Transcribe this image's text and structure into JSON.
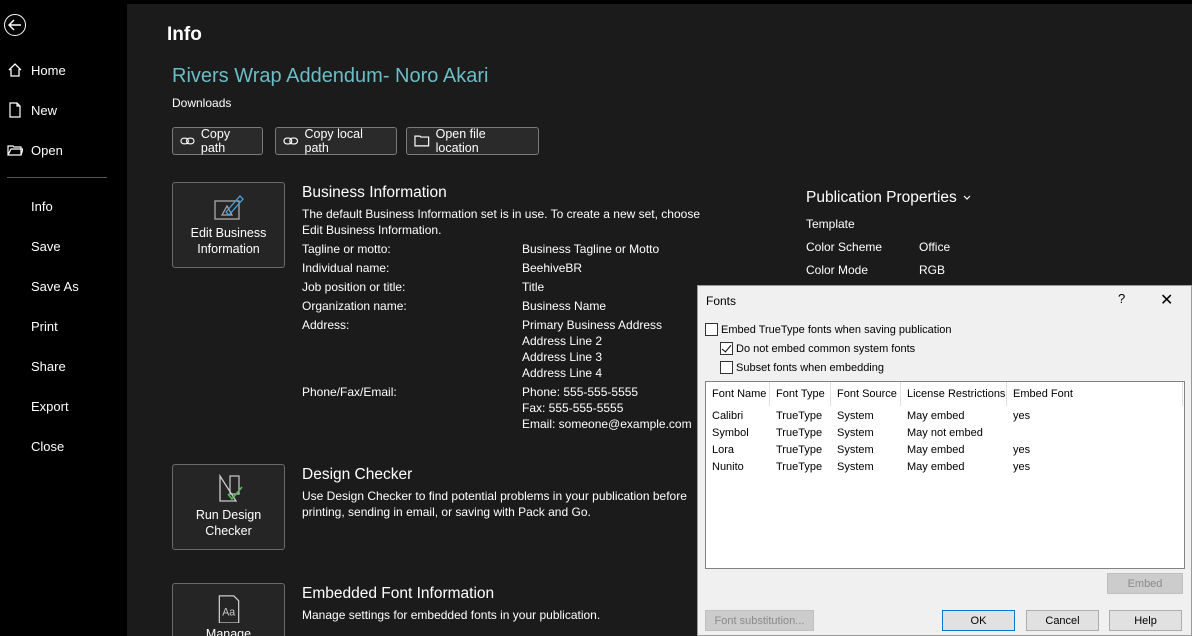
{
  "sidebar": {
    "back_icon": "back-arrow-icon",
    "items": [
      {
        "label": "Home",
        "icon": "home-icon"
      },
      {
        "label": "New",
        "icon": "new-file-icon"
      },
      {
        "label": "Open",
        "icon": "open-folder-icon"
      },
      {
        "label": "Info"
      },
      {
        "label": "Save"
      },
      {
        "label": "Save As"
      },
      {
        "label": "Print"
      },
      {
        "label": "Share"
      },
      {
        "label": "Export"
      },
      {
        "label": "Close"
      }
    ]
  },
  "main": {
    "page_title": "Info",
    "doc_title": "Rivers Wrap Addendum- Noro Akari",
    "doc_location": "Downloads",
    "path_buttons": [
      {
        "label": "Copy path"
      },
      {
        "label": "Copy local path"
      },
      {
        "label": "Open file location"
      }
    ],
    "business_info": {
      "button_label_1": "Edit Business",
      "button_label_2": "Information",
      "heading": "Business Information",
      "description": "The default Business Information set is in use. To create a new set, choose Edit Business Information.",
      "fields": [
        {
          "label": "Tagline or motto:",
          "value": "Business Tagline or Motto"
        },
        {
          "label": "Individual name:",
          "value": "BeehiveBR"
        },
        {
          "label": "Job position or title:",
          "value": "Title"
        },
        {
          "label": "Organization name:",
          "value": "Business Name"
        },
        {
          "label": "Address:",
          "value_lines": [
            "Primary Business Address",
            "Address Line 2",
            "Address Line 3",
            "Address Line 4"
          ]
        },
        {
          "label": "Phone/Fax/Email:",
          "value_lines": [
            "Phone: 555-555-5555",
            "Fax: 555-555-5555",
            "Email: someone@example.com"
          ]
        }
      ]
    },
    "design_checker": {
      "button_label_1": "Run Design",
      "button_label_2": "Checker",
      "heading": "Design Checker",
      "description": "Use Design Checker to find potential problems in your publication before printing, sending in email, or saving with Pack and Go."
    },
    "embedded_fonts": {
      "button_label": "Manage",
      "heading": "Embedded Font Information",
      "description": "Manage settings for embedded fonts in your publication."
    },
    "publication_properties": {
      "title": "Publication Properties",
      "rows": [
        {
          "label": "Template",
          "value": ""
        },
        {
          "label": "Color Scheme",
          "value": "Office"
        },
        {
          "label": "Color Mode",
          "value": "RGB"
        }
      ]
    }
  },
  "fonts_dialog": {
    "title": "Fonts",
    "help": "?",
    "close": "✕",
    "options": [
      {
        "label": "Embed TrueType fonts when saving publication",
        "checked": false
      },
      {
        "label": "Do not embed common system fonts",
        "checked": true
      },
      {
        "label": "Subset fonts when embedding",
        "checked": false
      }
    ],
    "columns": [
      "Font Name",
      "Font Type",
      "Font Source",
      "License Restrictions",
      "Embed Font"
    ],
    "rows": [
      [
        "Calibri",
        "TrueType",
        "System",
        "May embed",
        "yes"
      ],
      [
        "Symbol",
        "TrueType",
        "System",
        "May not embed",
        ""
      ],
      [
        "Lora",
        "TrueType",
        "System",
        "May embed",
        "yes"
      ],
      [
        "Nunito",
        "TrueType",
        "System",
        "May embed",
        "yes"
      ]
    ],
    "embed_button": "Embed",
    "font_substitution_button": "Font substitution...",
    "ok_button": "OK",
    "cancel_button": "Cancel",
    "help_button": "Help"
  },
  "colors": {
    "accent": "#6bbdc6",
    "sidebar_bg": "#000000",
    "main_bg": "#1b1b1b",
    "dialog_bg": "#f0f0f0"
  }
}
